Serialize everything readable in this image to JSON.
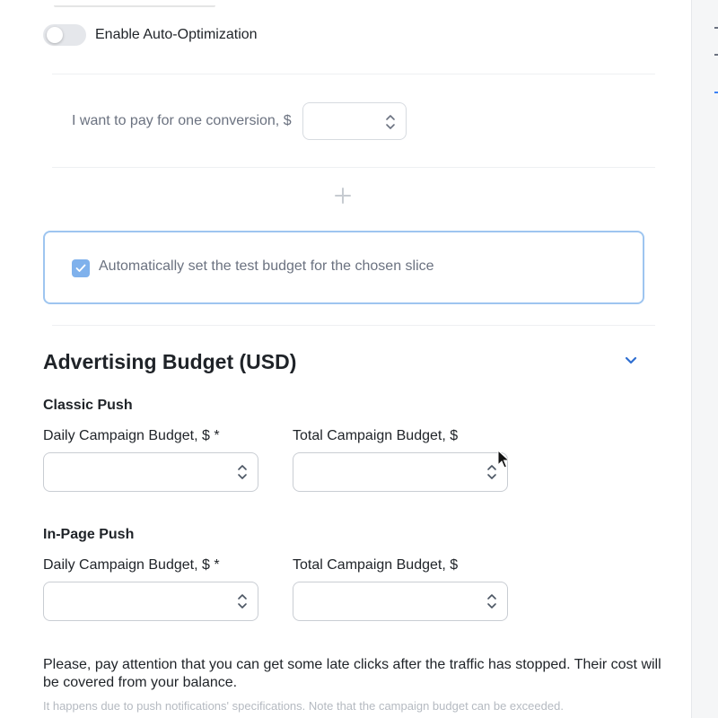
{
  "auto_optimization": {
    "label": "Enable Auto-Optimization",
    "enabled": false
  },
  "conversion": {
    "label": "I want to pay for one conversion, $",
    "value": ""
  },
  "auto_budget": {
    "label": "Automatically set the test budget for the chosen slice",
    "checked": true
  },
  "budget": {
    "title": "Advertising Budget (USD)",
    "classic_push": {
      "heading": "Classic Push",
      "daily_label": "Daily Campaign Budget, $ *",
      "total_label": "Total Campaign Budget, $",
      "daily_value": "",
      "total_value": ""
    },
    "in_page_push": {
      "heading": "In-Page Push",
      "daily_label": "Daily Campaign Budget, $ *",
      "total_label": "Total Campaign Budget, $",
      "daily_value": "",
      "total_value": ""
    },
    "note": "Please, pay attention that you can get some late clicks after the traffic has stopped. Their cost will be covered from your balance.",
    "note_small": "It happens due to push notifications' specifications. Note that the campaign budget can be exceeded."
  },
  "colors": {
    "accent": "#2f6fd1",
    "checkbox": "#7fb1ec",
    "box_border": "#9ec5f0"
  },
  "icons": {
    "add": "plus-icon",
    "collapse": "chevron-down-icon",
    "check": "check-icon"
  }
}
